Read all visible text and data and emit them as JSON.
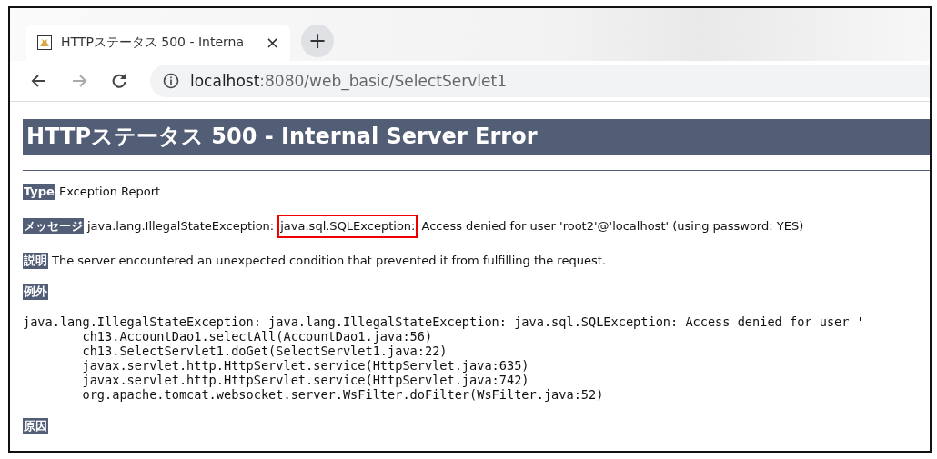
{
  "browser": {
    "tab": {
      "title": "HTTPステータス 500 - Interna",
      "close": "×"
    },
    "new_tab": "+",
    "address": {
      "host": "localhost",
      "path": ":8080/web_basic/SelectServlet1"
    }
  },
  "page": {
    "title": "HTTPステータス 500 - Internal Server Error",
    "sections": [
      {
        "kind": "field",
        "label": "Type",
        "parts": [
          {
            "text": "Exception Report"
          }
        ]
      },
      {
        "kind": "field",
        "label": "メッセージ",
        "parts": [
          {
            "text": "java.lang.IllegalStateException:"
          },
          {
            "text": "java.sql.SQLException:",
            "highlighted": true
          },
          {
            "text": "Access denied for user 'root2'@'localhost' (using password: YES)"
          }
        ]
      },
      {
        "kind": "field",
        "label": "説明",
        "parts": [
          {
            "text": "The server encountered an unexpected condition that prevented it from fulfilling the request."
          }
        ]
      },
      {
        "kind": "heading",
        "label": "例外"
      },
      {
        "kind": "stack",
        "lines": [
          "java.lang.IllegalStateException: java.lang.IllegalStateException: java.sql.SQLException: Access denied for user '",
          "\tch13.AccountDao1.selectAll(AccountDao1.java:56)",
          "\tch13.SelectServlet1.doGet(SelectServlet1.java:22)",
          "\tjavax.servlet.http.HttpServlet.service(HttpServlet.java:635)",
          "\tjavax.servlet.http.HttpServlet.service(HttpServlet.java:742)",
          "\torg.apache.tomcat.websocket.server.WsFilter.doFilter(WsFilter.java:52)"
        ]
      },
      {
        "kind": "heading",
        "label": "原因"
      }
    ]
  }
}
